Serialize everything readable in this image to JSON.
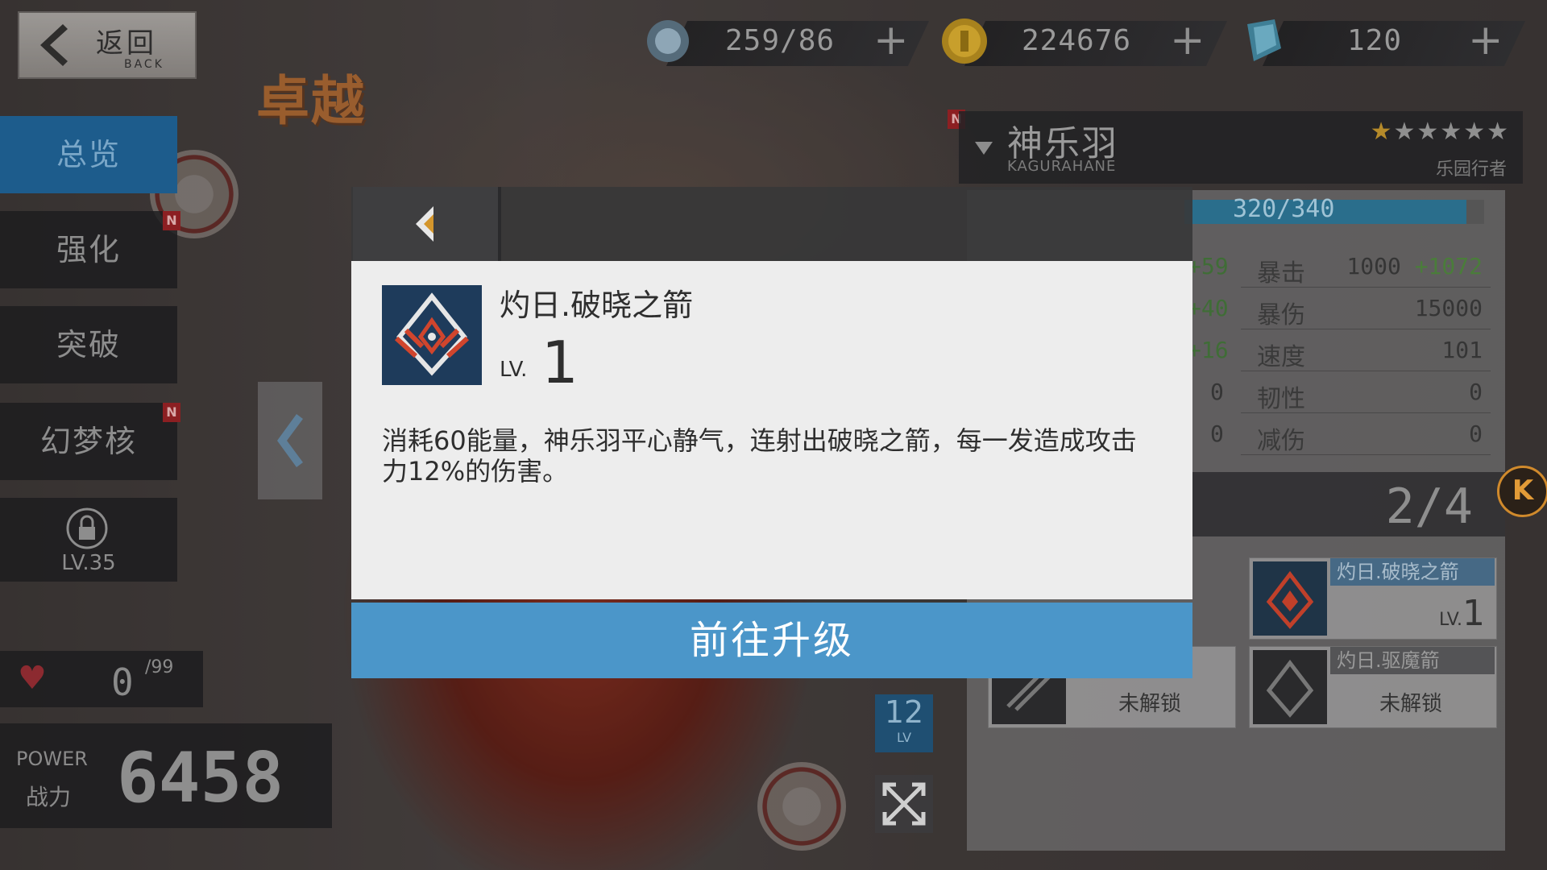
{
  "topbar": {
    "back_label": "返回",
    "back_sub": "BACK",
    "rank_label": "卓越",
    "resources": [
      {
        "icon": "stamina-icon",
        "value": "259/86",
        "plus": "+"
      },
      {
        "icon": "gold-coin-icon",
        "value": "224676",
        "plus": "+"
      },
      {
        "icon": "crystal-icon",
        "value": "120",
        "plus": "+"
      }
    ]
  },
  "sidebar": {
    "items": [
      {
        "label": "总览",
        "active": true,
        "badge": ""
      },
      {
        "label": "强化",
        "active": false,
        "badge": "N"
      },
      {
        "label": "突破",
        "active": false,
        "badge": ""
      },
      {
        "label": "幻梦核",
        "active": false,
        "badge": "N"
      }
    ],
    "locked_level": "LV.35",
    "affection_value": "0",
    "affection_max": "/99",
    "power_label_en": "POWER",
    "power_label_cn": "战力",
    "power_value": "6458"
  },
  "character": {
    "badge": "N",
    "name": "神乐羽",
    "name_en": "KAGURAHANE",
    "class": "乐园行者",
    "stars_filled": 1,
    "stars_total": 6,
    "hp_text": "320/340",
    "hp_fraction": 0.94,
    "stats_right": [
      {
        "name": "暴击",
        "value": "1000",
        "bonus": "+1072"
      },
      {
        "name": "暴伤",
        "value": "15000",
        "bonus": ""
      },
      {
        "name": "速度",
        "value": "101",
        "bonus": ""
      },
      {
        "name": "韧性",
        "value": "0",
        "bonus": ""
      },
      {
        "name": "减伤",
        "value": "0",
        "bonus": ""
      }
    ],
    "stats_left_bonus": [
      "+59",
      "+40",
      "+16"
    ],
    "stats_left_zero": [
      "0",
      "0"
    ],
    "level": "12",
    "level_label": "LV"
  },
  "skills": {
    "count": "2/4",
    "k_button": "K",
    "cards": [
      {
        "title": "灼日.破晓之箭",
        "lv_label": "LV.",
        "lv": "1",
        "locked": false
      },
      {
        "title": "灼日.驱魔箭",
        "locked_text": "未解锁",
        "locked": true
      },
      {
        "locked_text": "未解锁",
        "locked": true
      }
    ]
  },
  "dialog": {
    "skill_name": "灼日.破晓之箭",
    "lv_label": "LV.",
    "lv_value": "1",
    "description": "消耗60能量，神乐羽平心静气，连射出破晓之箭，每一发造成攻击力12%的伤害。",
    "upgrade_button": "前往升级"
  },
  "colors": {
    "accent_blue": "#4b96c9",
    "menu_active": "#1d5c8c",
    "badge_red": "#8c1f22",
    "rank_orange": "#b86a2b"
  }
}
